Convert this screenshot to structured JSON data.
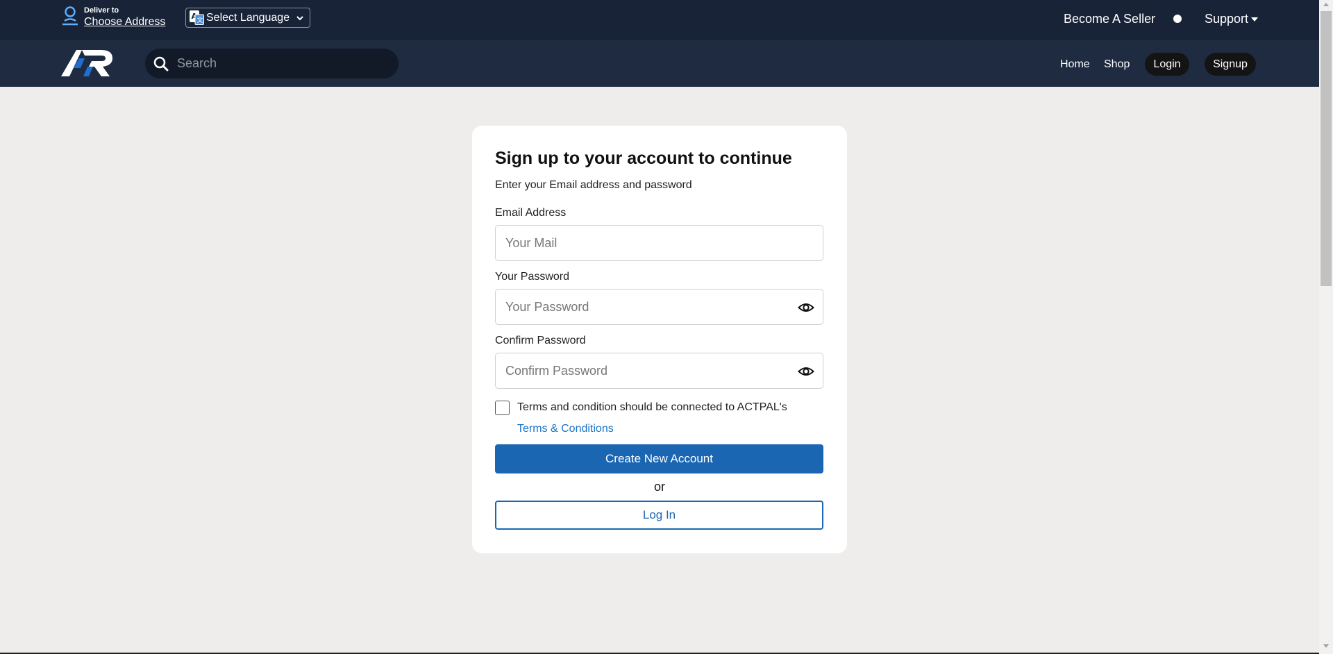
{
  "header": {
    "deliver_label": "Deliver to",
    "address_label": "Choose Address",
    "language_label": "Select Language",
    "become_seller": "Become A Seller",
    "support": "Support"
  },
  "nav": {
    "search_placeholder": "Search",
    "home": "Home",
    "shop": "Shop",
    "login": "Login",
    "signup": "Signup"
  },
  "form": {
    "title": "Sign up to your account to continue",
    "subtitle": "Enter your Email address and password",
    "email_label": "Email Address",
    "email_placeholder": "Your Mail",
    "email_value": "",
    "password_label": "Your Password",
    "password_placeholder": "Your Password",
    "confirm_label": "Confirm Password",
    "confirm_placeholder": "Confirm Password",
    "terms_text": "Terms and condition should be connected to ACTPAL's",
    "terms_link": "Terms & Conditions",
    "terms_checked": false,
    "create_button": "Create New Account",
    "or_text": "or",
    "login_button": "Log In"
  },
  "colors": {
    "topbar": "#182338",
    "navbar": "#1f2b40",
    "page_bg": "#eeedeb",
    "primary": "#1b66b2",
    "link": "#1a73c8"
  },
  "icons": {
    "deliver": "location-pin-icon",
    "language": "translate-icon",
    "language_chevron": "chevron-down-icon",
    "support_caret": "caret-down-icon",
    "search": "search-icon",
    "password_toggle": "eye-icon"
  }
}
